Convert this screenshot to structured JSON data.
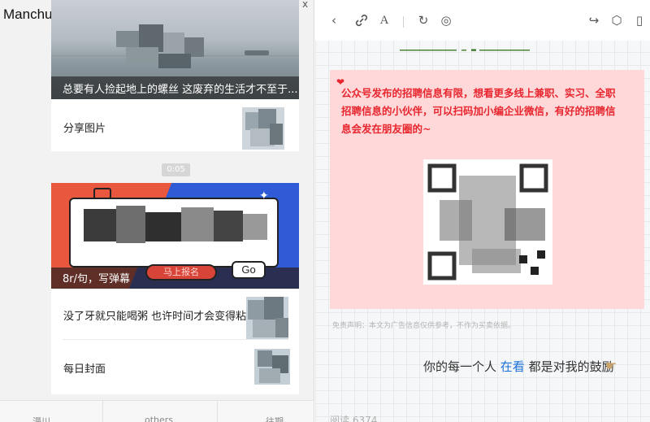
{
  "left_panel": {
    "title": "Manchuan",
    "card1": {
      "caption": "总要有人捡起地上的螺丝 这废弃的生活才不至于...",
      "item": "分享图片"
    },
    "time_badge": "0:05",
    "card2": {
      "banner_caption": "8r/句，写弹幕",
      "signup_label": "马上报名",
      "go_label": "Go",
      "item1": "没了牙就只能喝粥 也许时间才会变得粘稠",
      "item2": "每日封面"
    },
    "bottom_tabs": [
      "漫川",
      "others",
      "往期"
    ]
  },
  "right_panel": {
    "notice": "公众号发布的招聘信息有限，想看更多线上兼职、实习、全职招聘信息的小伙伴，可以扫码加小编企业微信，有好的招聘信息会发在朋友圈的~",
    "disclaimer": "免责声明：本文为广告信息仅供参考，不作为买卖依据。",
    "encourage": {
      "part1": "你的每一个人",
      "highlight": "在看",
      "part2": "都是对我的鼓励"
    },
    "read_count": "阅读 6374"
  },
  "colors": {
    "accent_red": "#e8262f",
    "pink_bg": "#ffd9d9",
    "banner_orange": "#e9573f",
    "banner_blue": "#2f5bd6",
    "highlight_blue": "#1a6fd8"
  },
  "icons": [
    "pin-icon",
    "back-icon",
    "link-icon",
    "font-size-icon",
    "refresh-icon",
    "globe-icon",
    "share-icon",
    "box-icon",
    "mini-program-icon",
    "heart-icon",
    "pointer-icon"
  ]
}
